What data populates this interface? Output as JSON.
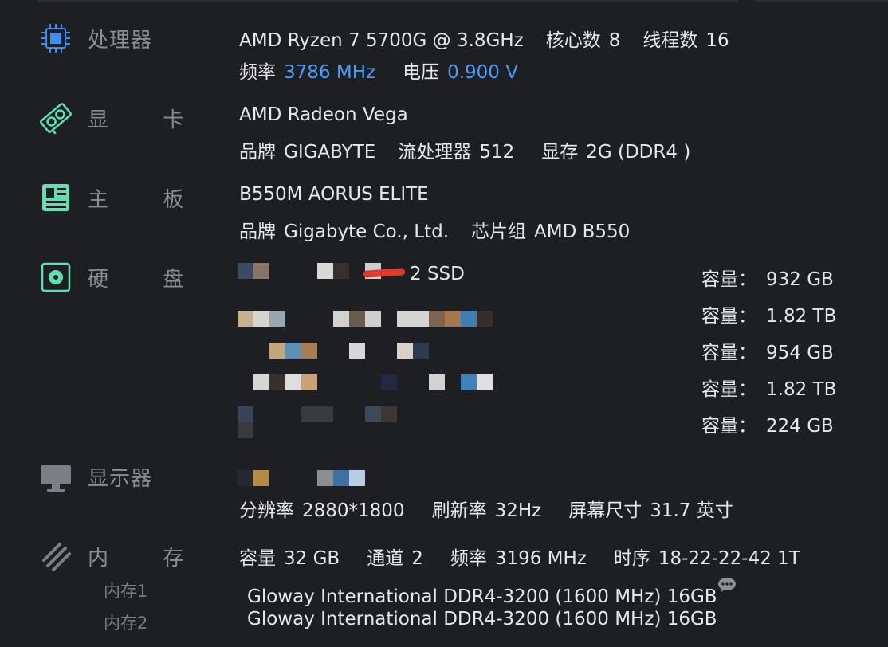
{
  "cpu": {
    "label": "处理器",
    "name": "AMD Ryzen 7 5700G @ 3.8GHz",
    "cores_label": "核心数",
    "cores_value": "8",
    "threads_label": "线程数",
    "threads_value": "16",
    "freq_label": "频率",
    "freq_value": "3786 MHz",
    "voltage_label": "电压",
    "voltage_value": "0.900 V"
  },
  "gpu": {
    "label": "显  卡",
    "name": "AMD Radeon Vega",
    "brand_label": "品牌",
    "brand_value": "GIGABYTE",
    "stream_label": "流处理器",
    "stream_value": "512",
    "vram_label": "显存",
    "vram_value": "2G (DDR4 )"
  },
  "motherboard": {
    "label": "主  板",
    "name": "B550M AORUS ELITE",
    "brand_label": "品牌",
    "brand_value": "Gigabyte Co., Ltd.",
    "chipset_label": "芯片组",
    "chipset_value": "AMD B550"
  },
  "disk": {
    "label": "硬  盘",
    "first_suffix": "2 SSD",
    "capacity_label": "容量：",
    "capacities": [
      "932 GB",
      "1.82 TB",
      "954 GB",
      "1.82 TB",
      "224 GB"
    ]
  },
  "monitor": {
    "label": "显示器",
    "resolution_label": "分辨率",
    "resolution_value": "2880*1800",
    "refresh_label": "刷新率",
    "refresh_value": "32Hz",
    "size_label": "屏幕尺寸",
    "size_value": "31.7 英寸"
  },
  "memory": {
    "label": "内  存",
    "capacity_label": "容量",
    "capacity_value": "32 GB",
    "channel_label": "通道",
    "channel_value": "2",
    "freq_label": "频率",
    "freq_value": "3196 MHz",
    "timing_label": "时序",
    "timing_value": "18-22-22-42 1T",
    "modules": [
      {
        "label": "内存1",
        "value": "Gloway International DDR4-3200 (1600 MHz) 16GB"
      },
      {
        "label": "内存2",
        "value": "Gloway International DDR4-3200 (1600 MHz) 16GB"
      }
    ]
  },
  "colors": {
    "background": "#1e1f22",
    "accent_blue": "#4a9df8",
    "icon_blue": "#3d8ef0",
    "icon_green": "#5fe0b0",
    "label_gray": "#8a8d93"
  },
  "icons": {
    "cpu": "cpu-icon",
    "gpu": "graphics-card-icon",
    "motherboard": "motherboard-icon",
    "disk": "disk-icon",
    "monitor": "monitor-icon",
    "memory": "memory-icon",
    "comment": "comment-bubble-icon"
  }
}
